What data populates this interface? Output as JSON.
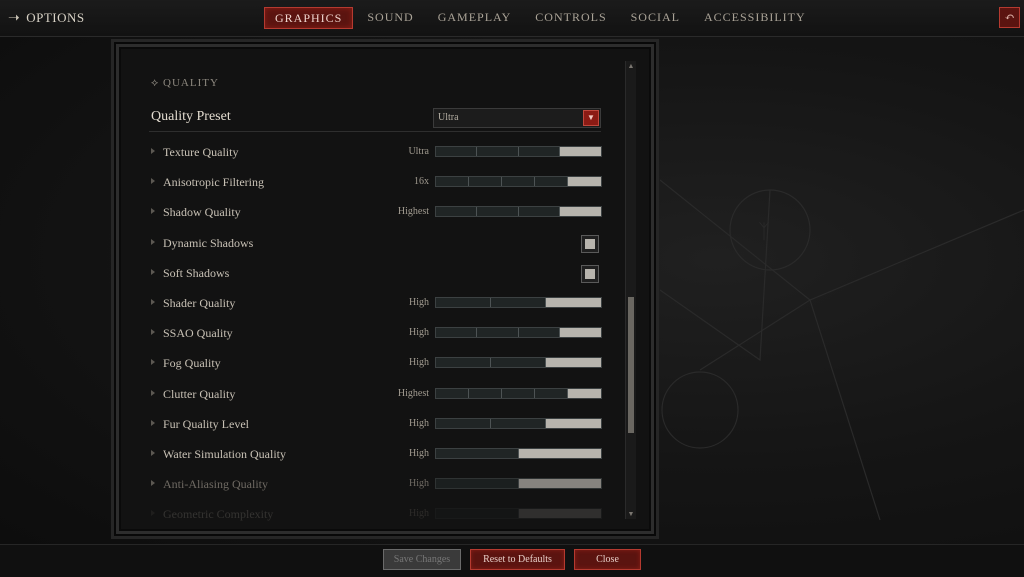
{
  "header": {
    "title": "OPTIONS",
    "tabs": [
      {
        "label": "GRAPHICS",
        "active": true
      },
      {
        "label": "SOUND",
        "active": false
      },
      {
        "label": "GAMEPLAY",
        "active": false
      },
      {
        "label": "CONTROLS",
        "active": false
      },
      {
        "label": "SOCIAL",
        "active": false
      },
      {
        "label": "ACCESSIBILITY",
        "active": false
      }
    ],
    "back_icon": "undo-arrow-icon"
  },
  "section": {
    "title": "QUALITY",
    "preset_label": "Quality Preset",
    "preset_value": "Ultra"
  },
  "settings": [
    {
      "label": "Texture Quality",
      "value": "Ultra",
      "type": "slider",
      "steps": 4,
      "level": 1.0
    },
    {
      "label": "Anisotropic Filtering",
      "value": "16x",
      "type": "slider",
      "steps": 5,
      "level": 1.0
    },
    {
      "label": "Shadow Quality",
      "value": "Highest",
      "type": "slider",
      "steps": 4,
      "level": 1.0
    },
    {
      "label": "Dynamic Shadows",
      "value": "",
      "type": "checkbox",
      "checked": true
    },
    {
      "label": "Soft Shadows",
      "value": "",
      "type": "checkbox",
      "checked": true
    },
    {
      "label": "Shader Quality",
      "value": "High",
      "type": "slider",
      "steps": 3,
      "level": 1.0
    },
    {
      "label": "SSAO Quality",
      "value": "High",
      "type": "slider",
      "steps": 4,
      "level": 1.0
    },
    {
      "label": "Fog Quality",
      "value": "High",
      "type": "slider",
      "steps": 3,
      "level": 1.0
    },
    {
      "label": "Clutter Quality",
      "value": "Highest",
      "type": "slider",
      "steps": 5,
      "level": 1.0
    },
    {
      "label": "Fur Quality Level",
      "value": "High",
      "type": "slider",
      "steps": 3,
      "level": 1.0
    },
    {
      "label": "Water Simulation Quality",
      "value": "High",
      "type": "slider",
      "steps": 2,
      "level": 1.0
    },
    {
      "label": "Anti-Aliasing Quality",
      "value": "High",
      "type": "slider",
      "steps": 2,
      "level": 1.0,
      "dim": true
    },
    {
      "label": "Geometric Complexity",
      "value": "High",
      "type": "slider",
      "steps": 2,
      "level": 1.0,
      "faded": true
    }
  ],
  "footer": {
    "save_label": "Save Changes",
    "reset_label": "Reset to Defaults",
    "close_label": "Close"
  },
  "colors": {
    "accent": "#8c1b14",
    "accent_border": "#b53a30",
    "slider_fill": "#b7b4ad",
    "background": "#151515"
  }
}
